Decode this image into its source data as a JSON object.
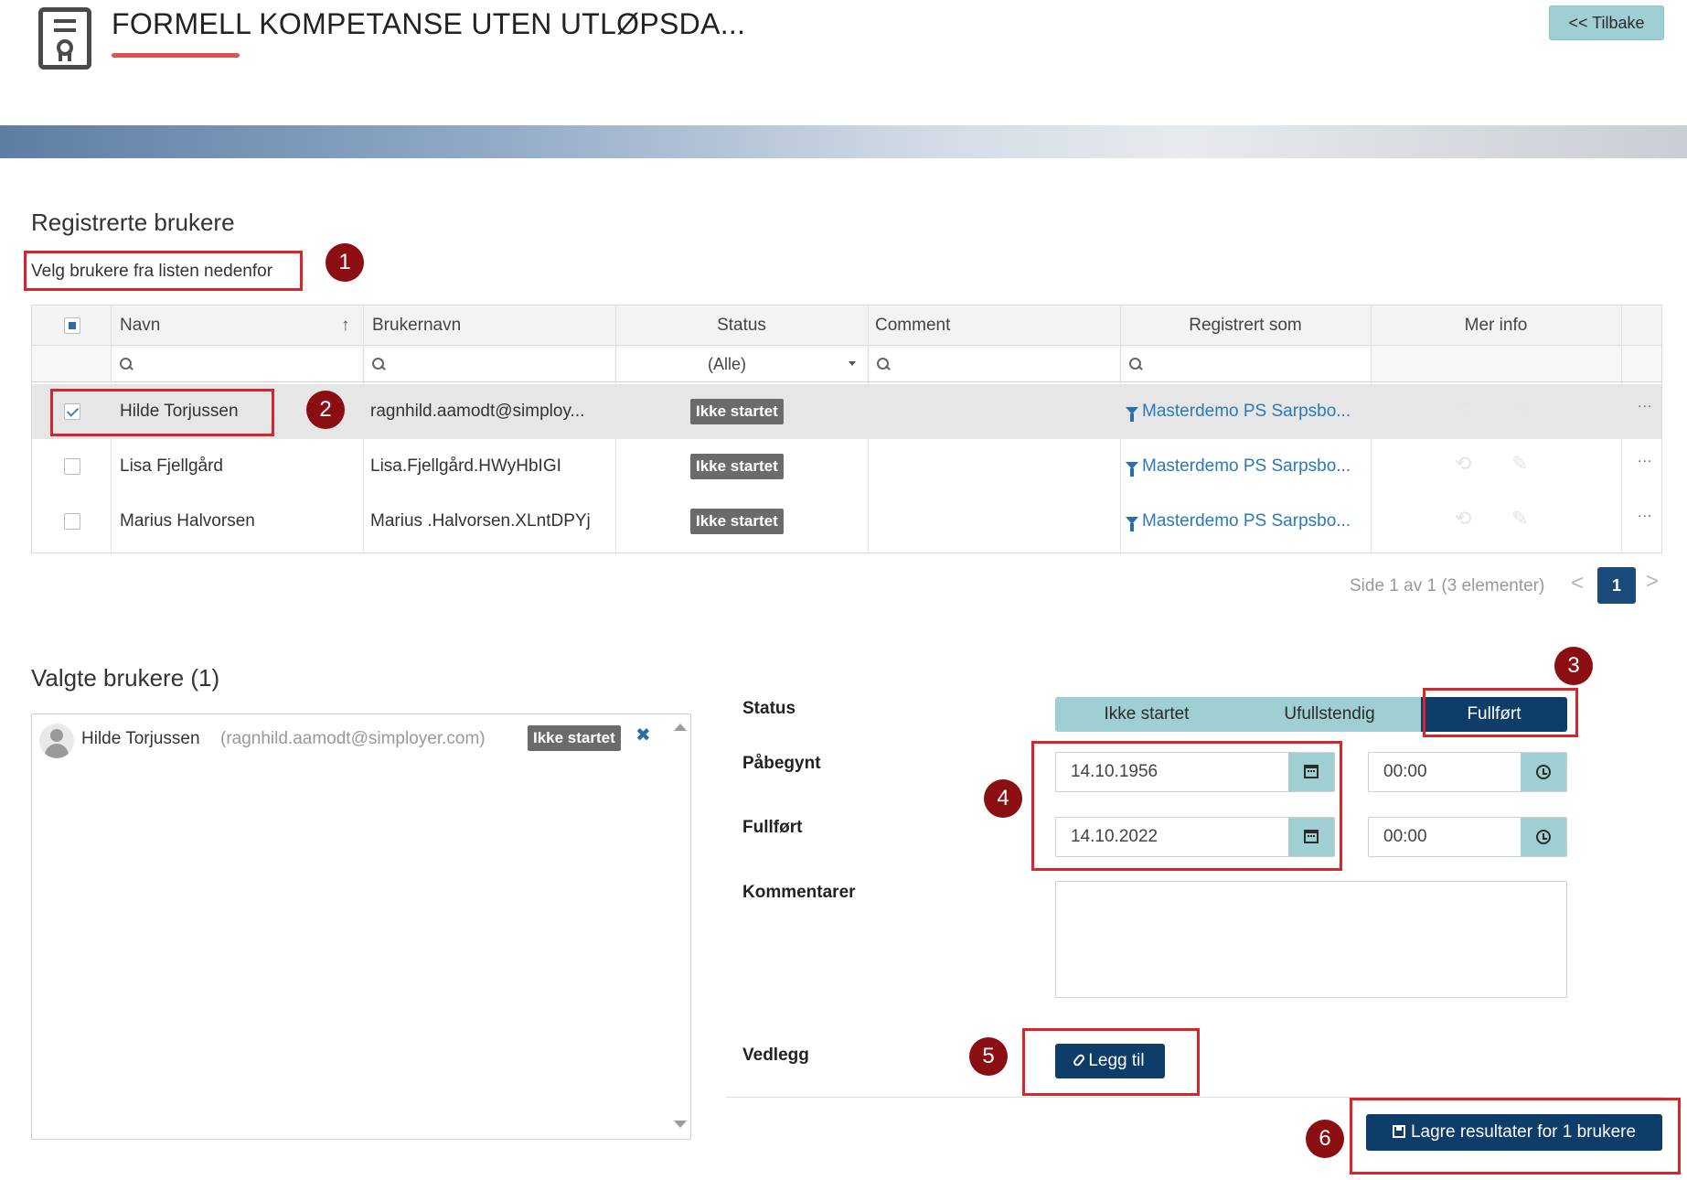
{
  "header": {
    "title": "FORMELL KOMPETANSE UTEN UTLØPSDA...",
    "back_label": "<< Tilbake"
  },
  "registered": {
    "heading": "Registrerte brukere",
    "hint": "Velg brukere fra listen nedenfor",
    "columns": {
      "name": "Navn",
      "sort_indicator": "↑",
      "username": "Brukernavn",
      "status": "Status",
      "comment": "Comment",
      "registered_as": "Registrert som",
      "more_info": "Mer info"
    },
    "status_filter": "(Alle)",
    "rows": [
      {
        "name": "Hilde Torjussen",
        "username": "ragnhild.aamodt@simploy...",
        "status": "Ikke startet",
        "registered_as": "Masterdemo PS Sarpsbo...",
        "selected": true
      },
      {
        "name": "Lisa Fjellgård",
        "username": "Lisa.Fjellgård.HWyHbIGI",
        "status": "Ikke startet",
        "registered_as": "Masterdemo PS Sarpsbo...",
        "selected": false
      },
      {
        "name": "Marius Halvorsen",
        "username": "Marius .Halvorsen.XLntDPYj",
        "status": "Ikke startet",
        "registered_as": "Masterdemo PS Sarpsbo...",
        "selected": false
      }
    ],
    "more_label": "...",
    "pager": {
      "info": "Side 1 av 1 (3 elementer)",
      "prev": "<",
      "next": ">",
      "current_page": "1"
    }
  },
  "selected_users": {
    "heading": "Valgte brukere (1)",
    "items": [
      {
        "name": "Hilde Torjussen",
        "email": "(ragnhild.aamodt@simployer.com)",
        "status": "Ikke startet",
        "remove": "✖"
      }
    ]
  },
  "form": {
    "status_label": "Status",
    "status_options": [
      "Ikke startet",
      "Ufullstendig",
      "Fullført"
    ],
    "status_selected": "Fullført",
    "started_label": "Påbegynt",
    "started_date": "14.10.1956",
    "started_time": "00:00",
    "completed_label": "Fullført",
    "completed_date": "14.10.2022",
    "completed_time": "00:00",
    "comments_label": "Kommentarer",
    "comments_value": "",
    "attachment_label": "Vedlegg",
    "add_label": "Legg til",
    "save_label": "Lagre resultater for 1 brukere"
  },
  "markers": [
    "1",
    "2",
    "3",
    "4",
    "5",
    "6"
  ],
  "colors": {
    "accent_teal": "#9fcfd3",
    "primary_navy": "#0f3d6a",
    "highlight_red": "#d7262b",
    "marker_dark_red": "#8b0e12",
    "link_blue": "#2a7ab9",
    "badge_grey": "#6b6b6b"
  },
  "icons": [
    "certificate-icon",
    "search-icon",
    "filter-icon",
    "history-icon",
    "paperclip-icon",
    "calendar-icon",
    "clock-icon",
    "user-avatar-icon",
    "save-icon"
  ]
}
